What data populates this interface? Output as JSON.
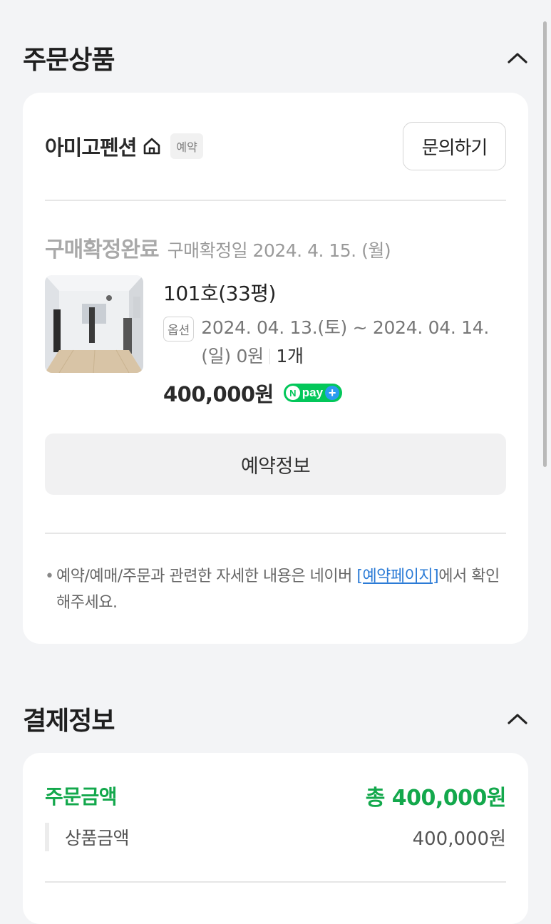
{
  "order_section": {
    "title": "주문상품",
    "store": {
      "name": "아미고펜션",
      "tag": "예약",
      "inquiry_label": "문의하기"
    },
    "status": {
      "label": "구매확정완료",
      "date_text": "구매확정일 2024. 4. 15. (월)"
    },
    "product": {
      "name": "101호(33평)",
      "option_badge": "옵션",
      "option_text": "2024. 04. 13.(토) ~ 2024. 04. 14. (일) 0원",
      "quantity": "1개",
      "price": "400,000원",
      "npay": "pay"
    },
    "reservation_button": "예약정보",
    "notice": {
      "text_before": "예약/예매/주문과 관련한 자세한 내용은 네이버 ",
      "link": "[예약페이지]",
      "text_after": "에서 확인해주세요."
    }
  },
  "payment_section": {
    "title": "결제정보",
    "order_amount_label": "주문금액",
    "order_amount_total": "총 400,000원",
    "product_amount_label": "상품금액",
    "product_amount_value": "400,000원"
  },
  "colors": {
    "accent_green": "#13a84c",
    "npay_green": "#03c75a",
    "link_blue": "#2b7bd6"
  }
}
